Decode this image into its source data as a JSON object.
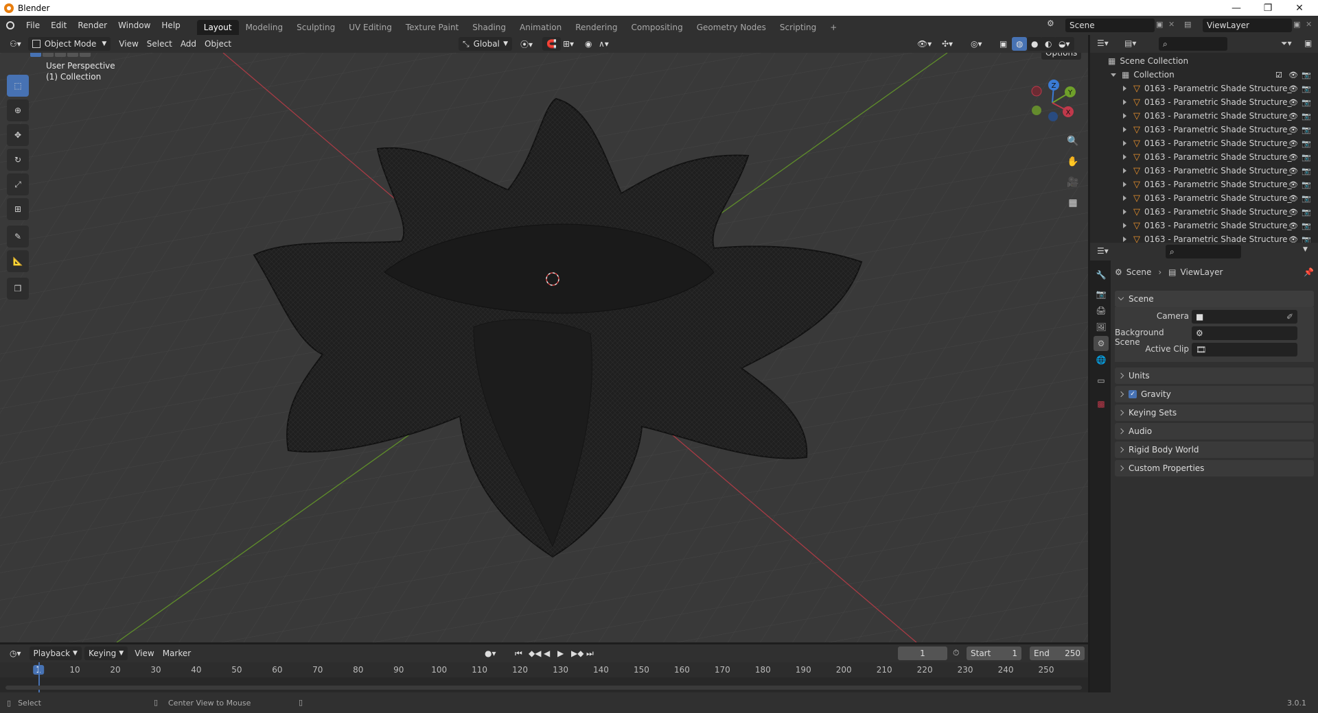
{
  "window": {
    "title": "Blender",
    "minimize": "—",
    "maximize": "❐",
    "close": "✕"
  },
  "menu": [
    "File",
    "Edit",
    "Render",
    "Window",
    "Help"
  ],
  "workspaces": [
    {
      "label": "Layout",
      "active": true
    },
    {
      "label": "Modeling"
    },
    {
      "label": "Sculpting"
    },
    {
      "label": "UV Editing"
    },
    {
      "label": "Texture Paint"
    },
    {
      "label": "Shading"
    },
    {
      "label": "Animation"
    },
    {
      "label": "Rendering"
    },
    {
      "label": "Compositing"
    },
    {
      "label": "Geometry Nodes"
    },
    {
      "label": "Scripting"
    }
  ],
  "add_workspace": "+",
  "scene_field": "Scene",
  "viewlayer_field": "ViewLayer",
  "viewport_header": {
    "mode": "Object Mode",
    "view": "View",
    "select": "Select",
    "add": "Add",
    "object": "Object",
    "transform": "Global",
    "options": "Options"
  },
  "viewport": {
    "perspective": "User Perspective",
    "collection": "(1) Collection",
    "gizmo": {
      "z": "Z",
      "y": "Y",
      "x": "X"
    }
  },
  "outliner": {
    "scene_collection": "Scene Collection",
    "collection": "Collection",
    "item_name": "0163 - Parametric Shade Structure_",
    "item_count": 12
  },
  "properties": {
    "breadcrumb_scene": "Scene",
    "breadcrumb_layer": "ViewLayer",
    "section": "Scene",
    "camera_label": "Camera",
    "background_label": "Background Scene",
    "active_clip_label": "Active Clip",
    "panels": [
      "Units",
      "Gravity",
      "Keying Sets",
      "Audio",
      "Rigid Body World",
      "Custom Properties"
    ],
    "gravity_checked": true
  },
  "timeline": {
    "playback": "Playback",
    "keying": "Keying",
    "view": "View",
    "marker": "Marker",
    "current_frame": "1",
    "start_label": "Start",
    "start": "1",
    "end_label": "End",
    "end": "250",
    "ticks": [
      "1",
      "10",
      "20",
      "30",
      "40",
      "50",
      "60",
      "70",
      "80",
      "90",
      "100",
      "110",
      "120",
      "130",
      "140",
      "150",
      "160",
      "170",
      "180",
      "190",
      "200",
      "210",
      "220",
      "230",
      "240",
      "250"
    ]
  },
  "status": {
    "left": "Select",
    "middle": "Center View to Mouse",
    "version": "3.0.1"
  },
  "colors": {
    "accent": "#4772b3",
    "x_axis": "#c0394b",
    "y_axis": "#6fa02a",
    "z_axis": "#3a7bd5",
    "object_icon": "#e8902d"
  }
}
